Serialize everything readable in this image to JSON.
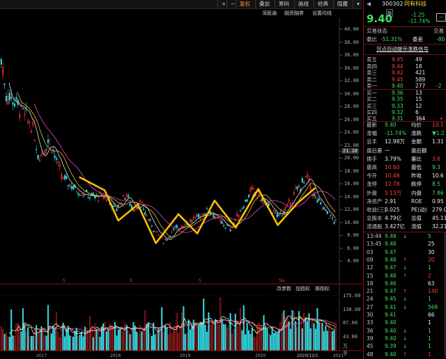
{
  "toolbar": {
    "buttons": [
      {
        "label": "+"
      },
      {
        "label": "−"
      },
      {
        "label": "复权",
        "active": true
      },
      {
        "label": "叠加"
      },
      {
        "label": "筹码"
      },
      {
        "label": "画线"
      },
      {
        "label": "经典"
      },
      {
        "label": "隐藏"
      }
    ],
    "row2": [
      "深股通",
      "融资融券",
      "设置均线"
    ]
  },
  "y_axis": [
    "40.00",
    "38.00",
    "36.00",
    "34.00",
    "32.00",
    "30.00",
    "28.00",
    "26.00",
    "24.00",
    "22.00",
    "21.10",
    "20.00",
    "18.00",
    "16.00",
    "14.00",
    "12.00",
    "10.00",
    "8.00",
    "6.00",
    "4.00"
  ],
  "sub_tools": [
    "改参数",
    "加指标",
    "换指标"
  ],
  "vol_axis": [
    "175.00",
    "130.00",
    "87.60",
    "43.80",
    "万手"
  ],
  "x_axis": [
    "2017",
    "2018",
    "2019",
    "2020",
    "2020/12/1",
    "2021"
  ],
  "marks": [
    "S",
    "S",
    "S",
    "S&"
  ],
  "colors": {
    "up": "#ff3030",
    "down": "#30d8e0",
    "annot": "#ffc000",
    "ma5": "#ffffff",
    "ma10": "#ffdc40",
    "ma20": "#ff50ff"
  },
  "chart_data": {
    "type": "line",
    "series": [
      {
        "points": [
          [
            9.5,
            17.0
          ],
          [
            12.8,
            15.0
          ],
          [
            14.6,
            10.3
          ],
          [
            17.2,
            12.8
          ],
          [
            19.6,
            6.8
          ],
          [
            22.6,
            11.3
          ],
          [
            25.1,
            8.3
          ],
          [
            27.4,
            13.4
          ],
          [
            30.2,
            9.2
          ],
          [
            33.2,
            15.2
          ],
          [
            35.8,
            9.6
          ],
          [
            38.4,
            13.0
          ],
          [
            40.7,
            15.3
          ]
        ]
      }
    ]
  },
  "quote": {
    "code": "300302",
    "name": "同有科技",
    "price": "9.40",
    "change": "-1.25",
    "change_pct": "-11.74%",
    "tag": "融"
  },
  "trade_status_label": "交易状态",
  "trade_status_label2": "交易",
  "ratio": {
    "label": "委比",
    "value": "-51.31%",
    "label2": "委差",
    "value2": "-80"
  },
  "auto_hint": "沉点自动提示涨跌信号",
  "asks": [
    {
      "label": "卖五",
      "price": "9.45",
      "vol": "49"
    },
    {
      "label": "卖四",
      "price": "9.44",
      "vol": "18"
    },
    {
      "label": "卖三",
      "price": "9.42",
      "vol": "421"
    },
    {
      "label": "卖二",
      "price": "9.41",
      "vol": "589"
    },
    {
      "label": "卖一",
      "price": "9.40",
      "vol": "277",
      "extra": "-2"
    }
  ],
  "bids": [
    {
      "label": "买一",
      "price": "9.36",
      "vol": "13"
    },
    {
      "label": "买二",
      "price": "9.35",
      "vol": "15"
    },
    {
      "label": "买三",
      "price": "9.33",
      "vol": "12"
    },
    {
      "label": "买四",
      "price": "9.32",
      "vol": "6"
    },
    {
      "label": "买五",
      "price": "9.31",
      "vol": "364",
      "extra": "+"
    }
  ],
  "stats": [
    {
      "l1": "最新",
      "v1": "9.40",
      "l2": "均价",
      "v2": "10.1",
      "c1": "green",
      "c2": "red"
    },
    {
      "l1": "涨幅",
      "v1": "-11.74%",
      "l2": "涨跌",
      "v2": "▼1.2",
      "c1": "green",
      "c2": "green"
    },
    {
      "l1": "总手",
      "v1": "12.98万",
      "l2": "金额",
      "v2": "1.31",
      "c1": "white",
      "c2": "white"
    },
    {
      "l1": "盘后量",
      "v1": "一",
      "l2": "盘后额",
      "v2": "",
      "c1": "white",
      "c2": "white"
    },
    {
      "l1": "换手",
      "v1": "3.79%",
      "l2": "量比",
      "v2": "3.6",
      "c1": "white",
      "c2": "red"
    },
    {
      "l1": "最高",
      "v1": "10.60",
      "l2": "最低",
      "v2": "9.3",
      "c1": "red",
      "c2": "green"
    },
    {
      "l1": "今开",
      "v1": "10.48",
      "l2": "昨收",
      "v2": "10.6",
      "c1": "red",
      "c2": "white"
    },
    {
      "l1": "涨停",
      "v1": "12.78",
      "l2": "跌停",
      "v2": "8.5",
      "c1": "red",
      "c2": "green"
    },
    {
      "l1": "外盘",
      "v1": "5.13万",
      "l2": "内盘",
      "v2": "7.86",
      "c1": "red",
      "c2": "green"
    },
    {
      "l1": "净资产",
      "v1": "2.91",
      "l2": "ROE",
      "v2": "0.95",
      "c1": "white",
      "c2": "white"
    },
    {
      "l1": "收益(三)",
      "v1": "0.025",
      "l2": "PE(动)",
      "v2": "279.0",
      "c1": "white",
      "c2": "white"
    },
    {
      "l1": "总股本",
      "v1": "4.79亿",
      "l2": "总值",
      "v2": "45.11",
      "c1": "white",
      "c2": "white"
    },
    {
      "l1": "流通股",
      "v1": "3.427亿",
      "l2": "流值",
      "v2": "32.21",
      "c1": "white",
      "c2": "white"
    }
  ],
  "ticks": [
    {
      "time": "13:44",
      "price": "9.48",
      "dir": "↓",
      "vol": "5",
      "pc": "green",
      "vc": "green"
    },
    {
      "time": "13:45",
      "price": "9.48",
      "dir": "",
      "vol": "25",
      "pc": "green",
      "vc": "white"
    },
    {
      "time": "03",
      "price": "9.47",
      "dir": "",
      "vol": "30",
      "pc": "green",
      "vc": "white"
    },
    {
      "time": "09",
      "price": "9.48",
      "dir": "↑",
      "vol": "20",
      "pc": "green",
      "vc": "red"
    },
    {
      "time": "12",
      "price": "9.47",
      "dir": "↓",
      "vol": "1",
      "pc": "green",
      "vc": "green"
    },
    {
      "time": "15",
      "price": "9.48",
      "dir": "↑",
      "vol": "2",
      "pc": "green",
      "vc": "red"
    },
    {
      "time": "18",
      "price": "9.46",
      "dir": "",
      "vol": "63",
      "pc": "green",
      "vc": "white"
    },
    {
      "time": "21",
      "price": "9.47",
      "dir": "↑",
      "vol": "140",
      "pc": "green",
      "vc": "red"
    },
    {
      "time": "24",
      "price": "9.45",
      "dir": "↓",
      "vol": "1",
      "pc": "green",
      "vc": "green"
    },
    {
      "time": "27",
      "price": "9.41",
      "dir": "↓",
      "vol": "568",
      "pc": "green",
      "vc": "green"
    },
    {
      "time": "30",
      "price": "9.41",
      "dir": "",
      "vol": "66",
      "pc": "green",
      "vc": "white"
    },
    {
      "time": "33",
      "price": "9.40",
      "dir": "",
      "vol": "1",
      "pc": "green",
      "vc": "white"
    },
    {
      "time": "36",
      "price": "9.40",
      "dir": "↓",
      "vol": "1",
      "pc": "green",
      "vc": "green"
    },
    {
      "time": "39",
      "price": "9.40",
      "dir": "↓",
      "vol": "1",
      "pc": "green",
      "vc": "green"
    },
    {
      "time": "45",
      "price": "9.39",
      "dir": "↓",
      "vol": "1",
      "pc": "green",
      "vc": "green"
    },
    {
      "time": "48",
      "price": "9.40",
      "dir": "↑",
      "vol": "1",
      "pc": "green",
      "vc": "red"
    }
  ]
}
